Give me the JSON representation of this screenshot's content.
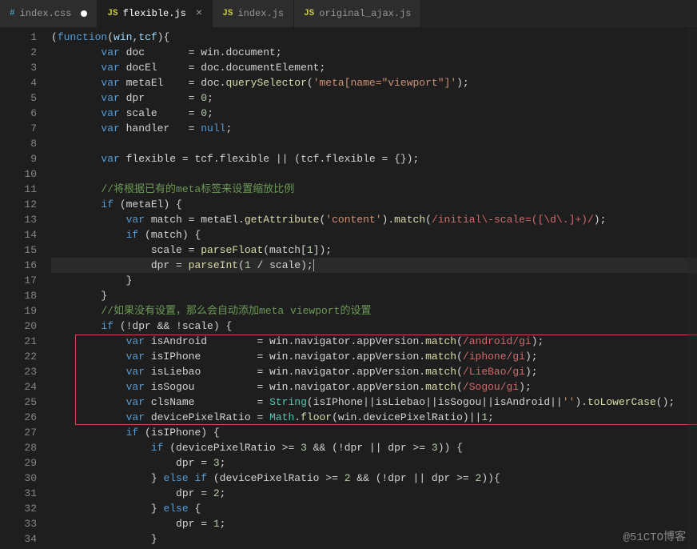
{
  "tabs": [
    {
      "icon": "css",
      "label": "index.css",
      "state": "dirty"
    },
    {
      "icon": "js",
      "label": "flexible.js",
      "state": "active"
    },
    {
      "icon": "js",
      "label": "index.js",
      "state": ""
    },
    {
      "icon": "js",
      "label": "original_ajax.js",
      "state": ""
    }
  ],
  "watermark": "@51CTO博客",
  "lines": [
    "1",
    "2",
    "3",
    "4",
    "5",
    "6",
    "7",
    "8",
    "9",
    "10",
    "11",
    "12",
    "13",
    "14",
    "15",
    "16",
    "17",
    "18",
    "19",
    "20",
    "21",
    "22",
    "23",
    "24",
    "25",
    "26",
    "27",
    "28",
    "29",
    "30",
    "31",
    "32",
    "33",
    "34"
  ],
  "code": {
    "l1": {
      "a": "(",
      "b": "function",
      "c": "(",
      "d": "win",
      "e": ",",
      "f": "tcf",
      "g": "){"
    },
    "l2": {
      "a": "        ",
      "b": "var",
      "c": " doc       = win.document;"
    },
    "l3": {
      "a": "        ",
      "b": "var",
      "c": " docEl     = doc.documentElement;"
    },
    "l4": {
      "a": "        ",
      "b": "var",
      "c": " metaEl    = doc.",
      "d": "querySelector",
      "e": "(",
      "f": "'meta[name=\"viewport\"]'",
      "g": ");"
    },
    "l5": {
      "a": "        ",
      "b": "var",
      "c": " dpr       = ",
      "d": "0",
      "e": ";"
    },
    "l6": {
      "a": "        ",
      "b": "var",
      "c": " scale     = ",
      "d": "0",
      "e": ";"
    },
    "l7": {
      "a": "        ",
      "b": "var",
      "c": " handler   = ",
      "d": "null",
      "e": ";"
    },
    "l9": {
      "a": "        ",
      "b": "var",
      "c": " flexible = tcf.flexible || (tcf.flexible = {});"
    },
    "l11": {
      "a": "        ",
      "b": "//将根据已有的meta标签来设置缩放比例"
    },
    "l12": {
      "a": "        ",
      "b": "if",
      "c": " (metaEl) {"
    },
    "l13": {
      "a": "            ",
      "b": "var",
      "c": " match = metaEl.",
      "d": "getAttribute",
      "e": "(",
      "f": "'content'",
      "g": ").",
      "h": "match",
      "i": "(",
      "j": "/initial\\-scale=([\\d\\.]+)/",
      "k": ");"
    },
    "l14": {
      "a": "            ",
      "b": "if",
      "c": " (match) {"
    },
    "l15": {
      "a": "                scale = ",
      "b": "parseFloat",
      "c": "(match[",
      "d": "1",
      "e": "]);"
    },
    "l16": {
      "a": "                dpr = ",
      "b": "parseInt",
      "c": "(",
      "d": "1",
      "e": " / scale);"
    },
    "l17": "            }",
    "l18": "        }",
    "l19": {
      "a": "        ",
      "b": "//如果没有设置，那么会自动添加meta viewport的设置"
    },
    "l20": {
      "a": "        ",
      "b": "if",
      "c": " (!dpr && !scale) {"
    },
    "l21": {
      "a": "            ",
      "b": "var",
      "c": " isAndroid        = win.navigator.appVersion.",
      "d": "match",
      "e": "(",
      "f": "/android/gi",
      "g": ");"
    },
    "l22": {
      "a": "            ",
      "b": "var",
      "c": " isIPhone         = win.navigator.appVersion.",
      "d": "match",
      "e": "(",
      "f": "/iphone/gi",
      "g": ");"
    },
    "l23": {
      "a": "            ",
      "b": "var",
      "c": " isLiebao         = win.navigator.appVersion.",
      "d": "match",
      "e": "(",
      "f": "/LieBao/gi",
      "g": ");"
    },
    "l24": {
      "a": "            ",
      "b": "var",
      "c": " isSogou          = win.navigator.appVersion.",
      "d": "match",
      "e": "(",
      "f": "/Sogou/gi",
      "g": ");"
    },
    "l25": {
      "a": "            ",
      "b": "var",
      "c": " clsName          = ",
      "d": "String",
      "e": "(isIPhone||isLiebao||isSogou||isAndroid||",
      "f": "''",
      "g": ").",
      "h": "toLowerCase",
      "i": "();"
    },
    "l26": {
      "a": "            ",
      "b": "var",
      "c": " devicePixelRatio = ",
      "d": "Math",
      "e": ".",
      "f": "floor",
      "g": "(win.devicePixelRatio)||",
      "h": "1",
      "i": ";"
    },
    "l27": {
      "a": "            ",
      "b": "if",
      "c": " (isIPhone) {"
    },
    "l28": {
      "a": "                ",
      "b": "if",
      "c": " (devicePixelRatio >= ",
      "d": "3",
      "e": " && (!dpr || dpr >= ",
      "f": "3",
      "g": ")) {"
    },
    "l29": {
      "a": "                    dpr = ",
      "b": "3",
      "c": ";"
    },
    "l30": {
      "a": "                } ",
      "b": "else if",
      "c": " (devicePixelRatio >= ",
      "d": "2",
      "e": " && (!dpr || dpr >= ",
      "f": "2",
      "g": ")){"
    },
    "l31": {
      "a": "                    dpr = ",
      "b": "2",
      "c": ";"
    },
    "l32": {
      "a": "                } ",
      "b": "else",
      "c": " {"
    },
    "l33": {
      "a": "                    dpr = ",
      "b": "1",
      "c": ";"
    },
    "l34": "                }"
  }
}
